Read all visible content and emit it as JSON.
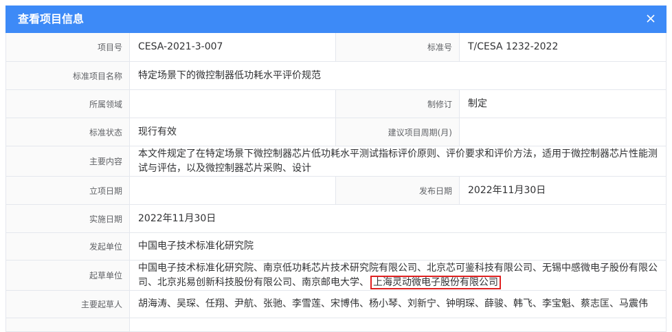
{
  "dialog": {
    "title": "查看项目信息",
    "close_icon": "close-icon"
  },
  "fields": {
    "project_no": {
      "label": "项目号",
      "value": "CESA-2021-3-007"
    },
    "standard_no": {
      "label": "标准号",
      "value": "T/CESA 1232-2022"
    },
    "standard_name": {
      "label": "标准项目名称",
      "value": "特定场景下的微控制器低功耗水平评价规范"
    },
    "domain": {
      "label": "所属领域",
      "value": ""
    },
    "revision": {
      "label": "制修订",
      "value": "制定"
    },
    "status": {
      "label": "标准状态",
      "value": "现行有效"
    },
    "cycle": {
      "label": "建议项目周期(月)",
      "value": ""
    },
    "content": {
      "label": "主要内容",
      "value": "本文件规定了在特定场景下微控制器芯片低功耗水平测试指标评价原则、评价要求和评价方法，适用于微控制器芯片性能测试与评估，以及微控制器芯片采购、设计"
    },
    "approval_date": {
      "label": "立项日期",
      "value": ""
    },
    "publish_date": {
      "label": "发布日期",
      "value": "2022年11月30日"
    },
    "implement_date": {
      "label": "实施日期",
      "value": "2022年11月30日"
    },
    "initiator": {
      "label": "发起单位",
      "value": "中国电子技术标准化研究院"
    },
    "drafters": {
      "label": "起草单位",
      "value_main": "中国电子技术标准化研究院、南京低功耗芯片技术研究院有限公司、北京芯可鉴科技有限公司、无锡中感微电子股份有限公司、北京兆易创新科技股份有限公司、南京邮电大学、",
      "value_highlight": "上海灵动微电子股份有限公司"
    },
    "main_drafters": {
      "label": "主要起草人",
      "value": "胡海涛、吴琛、任翔、尹航、张驰、李雪莲、宋博伟、杨小琴、刘新宁、钟明琛、薛骏、韩飞、李宝魁、蔡志匡、马震伟"
    }
  },
  "colors": {
    "header": "#3d8af7",
    "highlight_border": "#e02020",
    "label_bg": "#fafafa",
    "border": "#e4e7ed"
  }
}
